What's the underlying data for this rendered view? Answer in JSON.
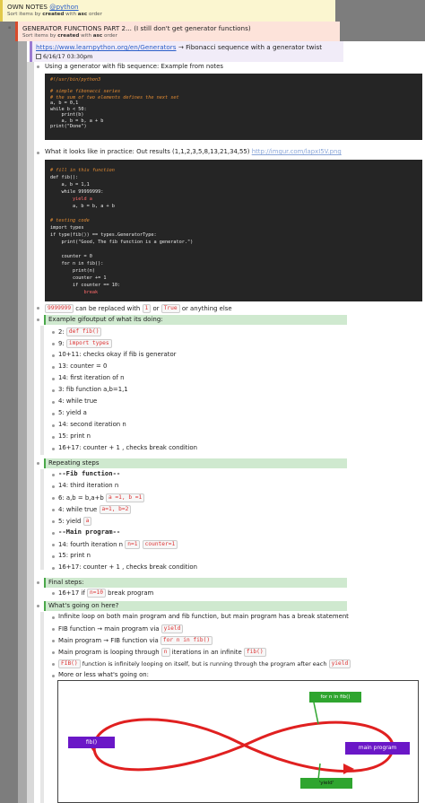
{
  "root": {
    "title": "OWN NOTES",
    "tag": "@python",
    "sort": "Sort items by",
    "sort_by": "created",
    "sort_with": "with",
    "sort_order": "asc",
    "sort_end": "order"
  },
  "sub": {
    "title": "GENERATOR FUNCTIONS PART 2... (I still don't get generator functions)",
    "sort": "Sort items by",
    "sort_by": "created",
    "sort_with": "with",
    "sort_order": "asc",
    "sort_end": "order"
  },
  "item": {
    "link": "https://www.learnpython.org/en/Generators",
    "arrow": "→",
    "desc": "Fibonacci sequence with a generator twist",
    "date": "6/16/17 03:30pm"
  },
  "using": "Using a generator with fib sequence: Example from notes",
  "code1": [
    "#!/usr/bin/python3",
    "",
    "# simple fibonacci series",
    "# the sum of two elements defines the next set",
    "a, b = 0,1",
    "while b < 50:",
    "    print(b)",
    "    a, b = b, a + b",
    "print(\"Done\")"
  ],
  "looks": {
    "text": "What it looks like in practice: Out results (1,1,2,3,5,8,13,21,34,55)",
    "link": "http://imgur.com/lapxI5V.png"
  },
  "code2": [
    "# fill in this function",
    "def fib():",
    "    a, b = 1,1",
    "    while 99999999:",
    "        yield a",
    "        a, b = b, a + b",
    "",
    "# testing code",
    "import types",
    "if type(fib()) == types.GeneratorType:",
    "    print(\"Good, The fib function is a generator.\")",
    "",
    "    counter = 0",
    "    for n in fib():",
    "        print(n)",
    "        counter += 1",
    "        if counter == 10:",
    "            break"
  ],
  "replace": {
    "a": "9999999",
    "b": "can be replaced with",
    "c": "1",
    "d": "or",
    "e": "True",
    "f": "or anything else"
  },
  "sec1": {
    "title": "Example gifoutput of what its doing:",
    "rows": [
      {
        "pre": "2:",
        "code": "def fib()",
        "post": ""
      },
      {
        "pre": "9:",
        "code": "import types",
        "post": ""
      },
      {
        "pre": "10+11: checks okay if fib is generator",
        "code": "",
        "post": ""
      },
      {
        "pre": "13: counter = 0",
        "code": "",
        "post": ""
      },
      {
        "pre": "14: first iteration of n",
        "code": "",
        "post": ""
      },
      {
        "pre": "3: fib function a,b=1,1",
        "code": "",
        "post": ""
      },
      {
        "pre": "4: while true",
        "code": "",
        "post": ""
      },
      {
        "pre": "5: yield a",
        "code": "",
        "post": ""
      },
      {
        "pre": "14: second iteration n",
        "code": "",
        "post": ""
      },
      {
        "pre": "15: print n",
        "code": "",
        "post": ""
      },
      {
        "pre": "16+17: counter + 1 , checks break condition",
        "code": "",
        "post": ""
      }
    ]
  },
  "sec2": {
    "title": "Repeating steps",
    "rows": [
      {
        "pre": "",
        "bold": "--Fib function--"
      },
      {
        "pre": "14: third iteration n"
      },
      {
        "pre": "6: a,b  = b,a+b",
        "code": "a =1, b =1"
      },
      {
        "pre": "4: while true",
        "code": "a=1, b=2"
      },
      {
        "pre": "5: yield",
        "code": "a"
      },
      {
        "pre": "",
        "bold": "--Main program--"
      },
      {
        "pre": "14: fourth iteration n",
        "code": "n=1",
        "code2": "counter=1"
      },
      {
        "pre": "15: print n"
      },
      {
        "pre": "16+17: counter + 1 , checks break condition"
      }
    ]
  },
  "sec3": {
    "title": "Final steps:",
    "pre": "16+17 if",
    "code": "n=10",
    "post": "break program"
  },
  "sec4": {
    "title": "What's going on here?",
    "r1": "Infinite loop on both main program and fib function, but main program has a break statement",
    "r2a": "FIB function",
    "r2b": "→ main program via",
    "r2c": "yield",
    "r3a": "Main program",
    "r3b": "→ FIB function via",
    "r3c": "for n in fib()",
    "r4a": "Main program is looping through",
    "r4b": "n",
    "r4c": "iterations in an infinite",
    "r4d": "fib()",
    "r5a": "FIB()",
    "r5b": "function is infinitely looping on itself, but is running through the program after each",
    "r5c": "yield",
    "r6": "More or less what's going on:"
  },
  "diagram": {
    "fib": "fib()",
    "main": "main program",
    "forn": "for n in fib()",
    "yield": "'yield'"
  },
  "colors": {
    "root_bg": "#fbf6d0",
    "sub_bg": "#fde3da",
    "item_bg": "#f1ecf8",
    "sec_bg": "#cfe9cf",
    "purple": "#6a17c7",
    "green": "#2fa52f",
    "red": "#e02020"
  }
}
